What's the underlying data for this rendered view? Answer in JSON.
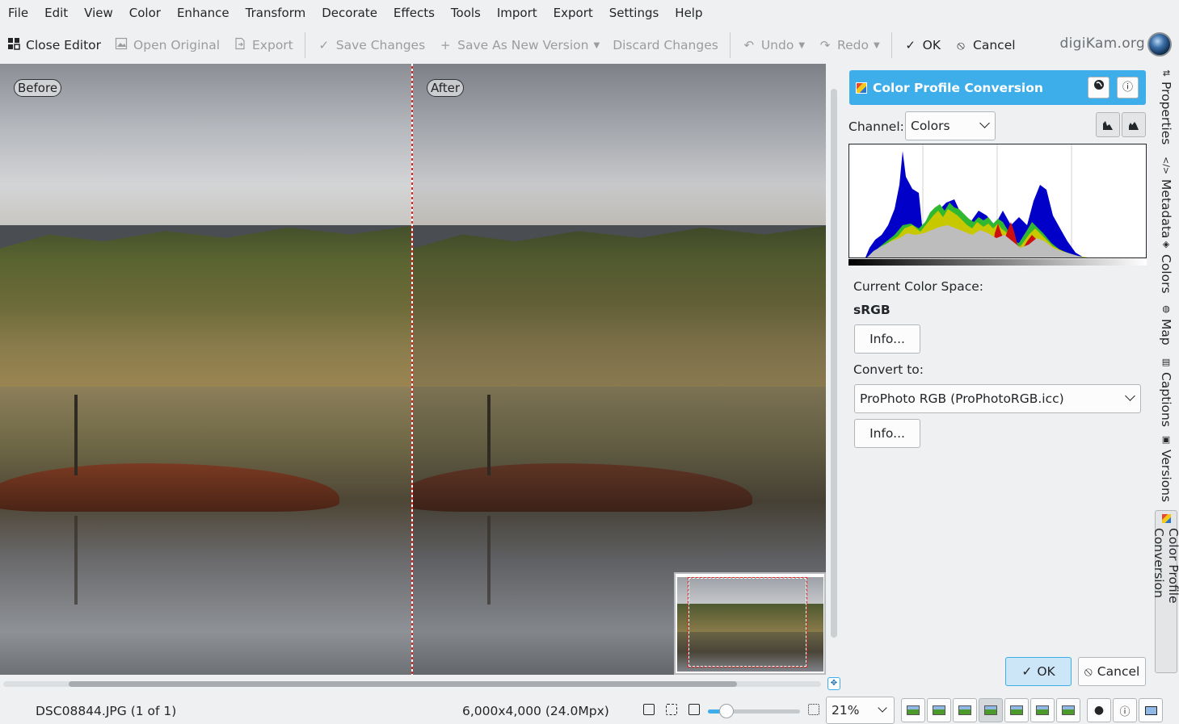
{
  "menu": [
    "File",
    "Edit",
    "View",
    "Color",
    "Enhance",
    "Transform",
    "Decorate",
    "Effects",
    "Tools",
    "Import",
    "Export",
    "Settings",
    "Help"
  ],
  "toolbar": {
    "close_editor": "Close Editor",
    "open_original": "Open Original",
    "export": "Export",
    "save_changes": "Save Changes",
    "save_as_new_version": "Save As New Version",
    "discard_changes": "Discard Changes",
    "undo": "Undo",
    "redo": "Redo",
    "ok": "OK",
    "cancel": "Cancel"
  },
  "brand": "digiKam.org",
  "canvas": {
    "before_label": "Before",
    "after_label": "After"
  },
  "tool_panel": {
    "title": "Color Profile Conversion",
    "channel_label": "Channel:",
    "channel_value": "Colors",
    "current_space_label": "Current Color Space:",
    "current_space_value": "sRGB",
    "info_button_1": "Info...",
    "convert_to_label": "Convert to:",
    "convert_to_value": "ProPhoto RGB (ProPhotoRGB.icc)",
    "info_button_2": "Info...",
    "ok": "OK",
    "cancel": "Cancel"
  },
  "side_tabs": [
    "Properties",
    "Metadata",
    "Colors",
    "Map",
    "Captions",
    "Versions",
    "Color Profile Conversion"
  ],
  "status": {
    "file": "DSC08844.JPG (1 of 1)",
    "dimensions": "6,000x4,000 (24.0Mpx)",
    "zoom": "21%",
    "zoom_fraction": 0.12
  },
  "colors": {
    "accent": "#3daee9",
    "divider_red": "#e32222"
  }
}
